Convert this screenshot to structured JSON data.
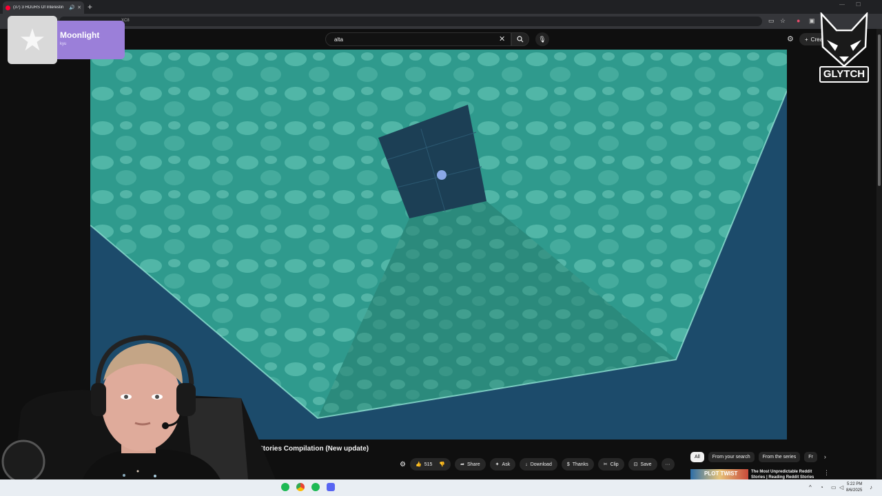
{
  "browser": {
    "tab_title": "(37) 3 HOURS Of Interestin",
    "new_tab": "+",
    "url_tail": "XC8"
  },
  "youtube": {
    "search_value": "alta",
    "create_label": "Create",
    "video_title": "ddit Stories Compilation (New update)",
    "like_count": "515",
    "actions": {
      "share": "Share",
      "ask": "Ask",
      "download": "Download",
      "thanks": "Thanks",
      "clip": "Clip",
      "save": "Save"
    },
    "chips": [
      "All",
      "From your search",
      "From the series",
      "Fr"
    ],
    "recommended": {
      "thumb_text": "PLOT TWIST",
      "title": "The Most Unpredictable Reddit Stories | Reading Reddit Stories"
    }
  },
  "notification": {
    "title": "Moonlight",
    "subtitle": "kyu"
  },
  "overlay_logo": "GLYTCH",
  "taskbar": {
    "time": "5:22 PM",
    "date": "8/6/2025"
  },
  "colors": {
    "youtube_bg": "#0f0f0f",
    "notification_accent": "#9b7fd9",
    "video_water": "#2a8f86"
  }
}
